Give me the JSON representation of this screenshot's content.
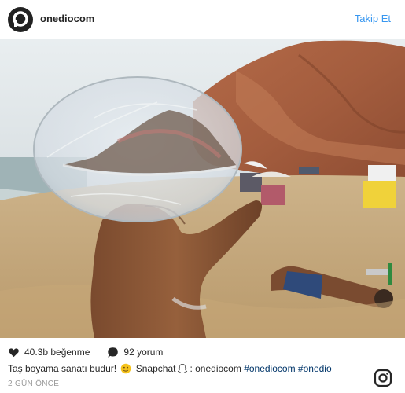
{
  "header": {
    "username": "onediocom",
    "follow_label": "Takip Et"
  },
  "post": {
    "likes_label": "40.3b beğenme",
    "comments_label": "92 yorum",
    "caption": {
      "text_start": "Taş boyama sanatı budur! ",
      "snapchat_label": " Snapchat",
      "handle": ": onediocom ",
      "tags": [
        "#onediocom",
        "#onedio"
      ]
    },
    "time": "2 GÜN ÖNCE"
  },
  "icons": {
    "avatar": "onedio-logo-icon",
    "like": "heart-icon",
    "comment": "comment-bubble-icon",
    "caption_emoji": "emoji-face-icon",
    "snapchat": "snapchat-ghost-icon",
    "instagram": "instagram-icon"
  },
  "colors": {
    "link_blue": "#3897f0",
    "hashtag": "#003569",
    "muted": "#999999"
  }
}
